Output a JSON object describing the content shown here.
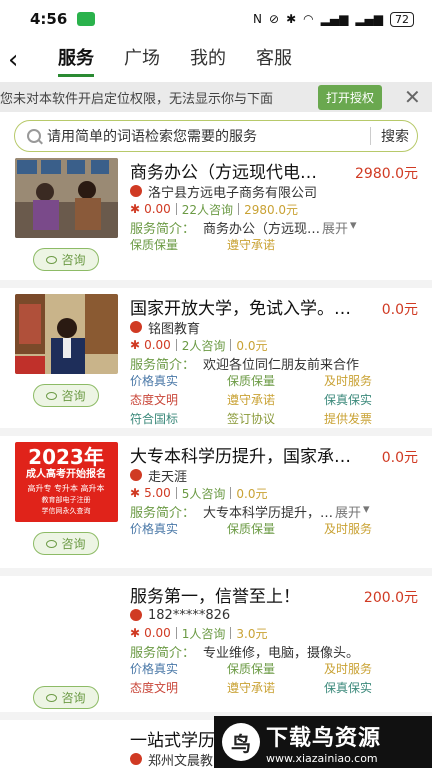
{
  "status": {
    "time": "4:56",
    "battery": "72"
  },
  "nav": {
    "tabs": [
      "服务",
      "广场",
      "我的",
      "客服"
    ]
  },
  "banner": {
    "message": "您未对本软件开启定位权限，无法显示你与下面",
    "button": "打开授权"
  },
  "search": {
    "placeholder": "请用简单的词语检索您需要的服务",
    "button": "搜索"
  },
  "consult_label": "咨询",
  "intro_label": "服务简介：",
  "cards": [
    {
      "title": "商务办公（方远现代电…",
      "price": "2980.0元",
      "org": "洛宁县方远电子商务有限公司",
      "score": "0.00",
      "count": "22人咨询",
      "amount": "2980.0元",
      "intro": "商务办公（方远现…",
      "more": "展开",
      "tags": [
        "保质保量",
        "遵守承诺"
      ]
    },
    {
      "title": "国家开放大学，免试入学。…",
      "price": "0.0元",
      "org": "铭图教育",
      "score": "0.00",
      "count": "2人咨询",
      "amount": "0.0元",
      "intro": "欢迎各位同仁朋友前来合作",
      "more": "",
      "tags": [
        "价格真实",
        "保质保量",
        "及时服务",
        "态度文明",
        "遵守承诺",
        "保真保实",
        "符合国标",
        "签订协议",
        "提供发票"
      ]
    },
    {
      "title": "大专本科学历提升，国家承…",
      "price": "0.0元",
      "org": "走天涯",
      "score": "5.00",
      "count": "5人咨询",
      "amount": "0.0元",
      "intro": "大专本科学历提升，…",
      "more": "展开",
      "tags": [
        "价格真实",
        "保质保量",
        "及时服务"
      ],
      "thumb_text": {
        "year": "2023年",
        "line2": "成人高考开始报名",
        "line3": "高升专 专升本 高升本",
        "line4": "教育部电子注册",
        "line5": "学信网永久查询"
      }
    },
    {
      "title": "服务第一，信誉至上！",
      "price": "200.0元",
      "org": "182*****826",
      "score": "0.00",
      "count": "1人咨询",
      "amount": "3.0元",
      "intro": "专业维修，电脑，摄像头。",
      "more": "",
      "tags": [
        "价格真实",
        "保质保量",
        "及时服务",
        "态度文明",
        "遵守承诺",
        "保真保实"
      ]
    },
    {
      "title": "一站式学历",
      "org": "郑州文晨教"
    }
  ],
  "watermark": {
    "title": "下载鸟资源",
    "url": "www.xiazainiao.com"
  }
}
